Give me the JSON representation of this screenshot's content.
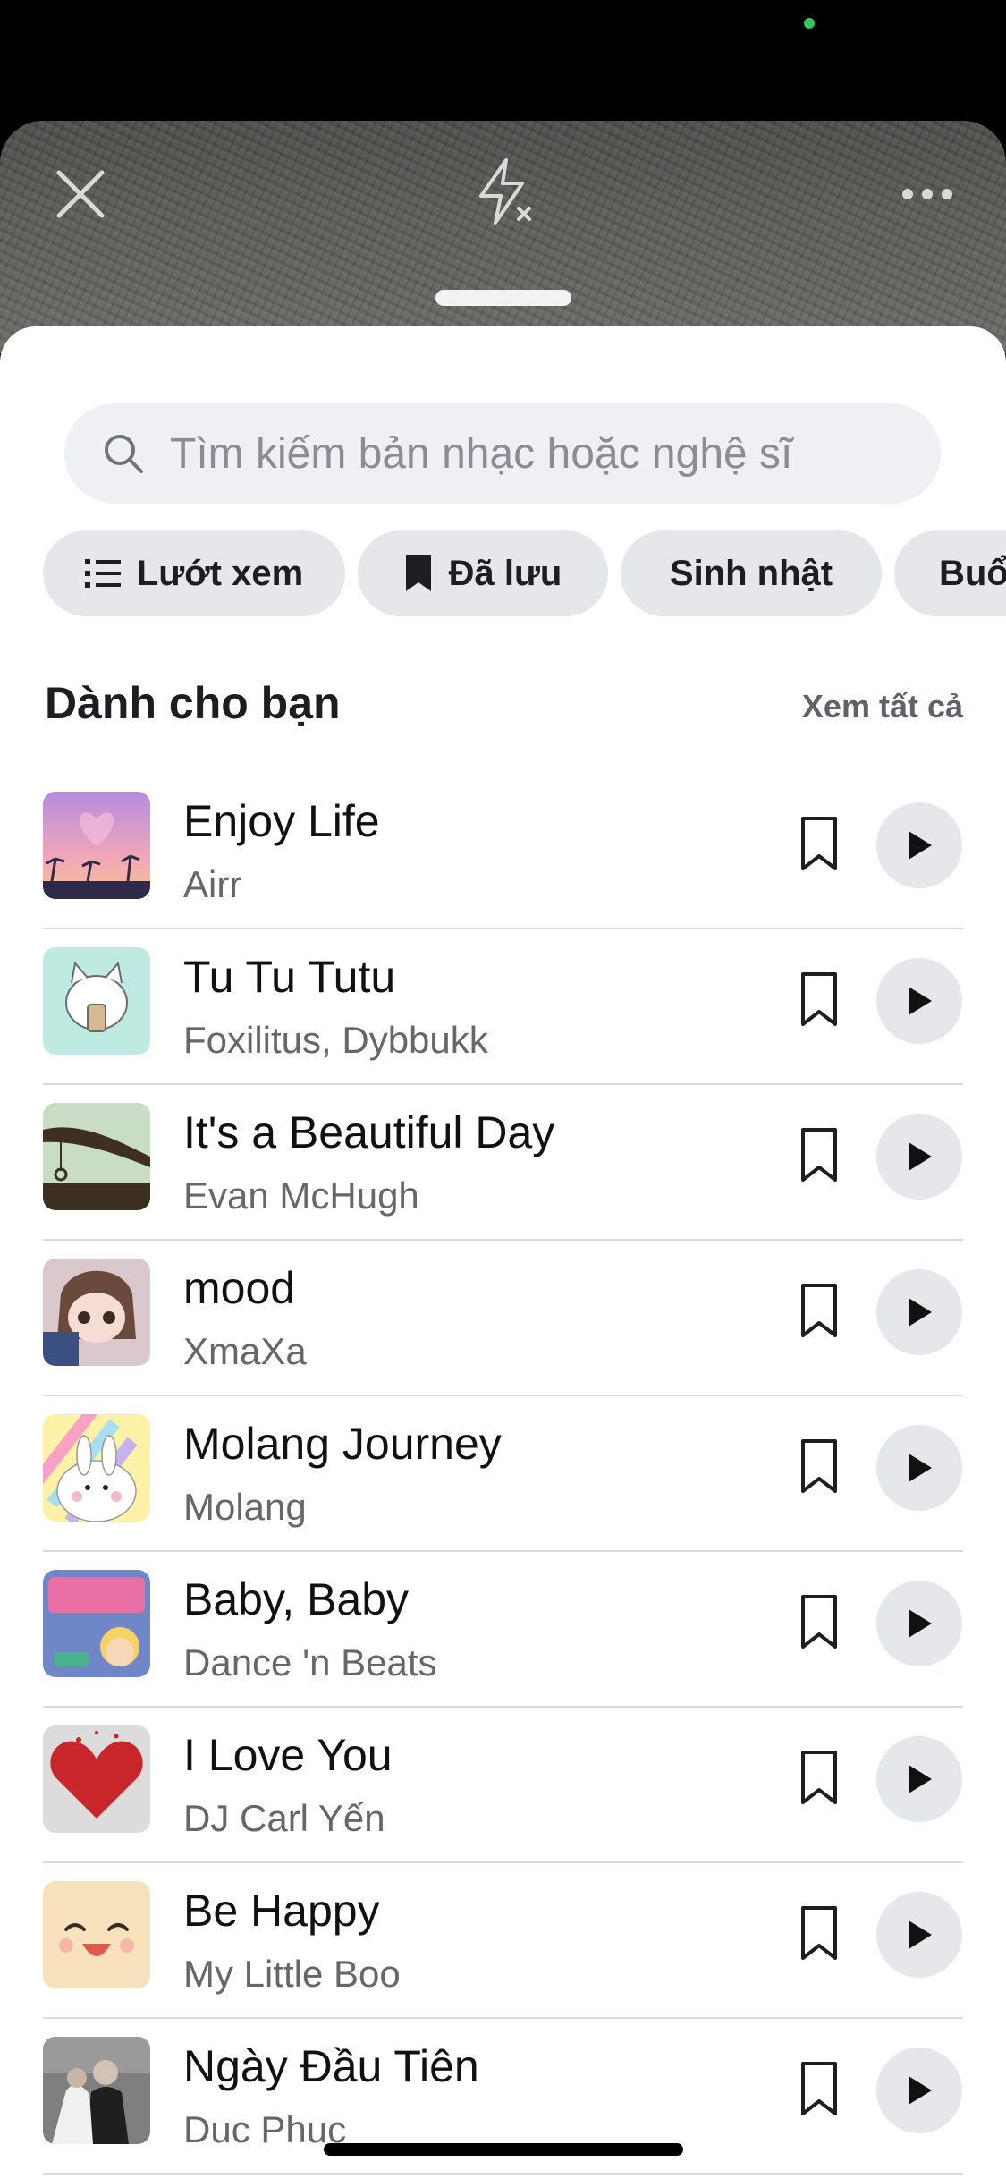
{
  "search": {
    "placeholder": "Tìm kiếm bản nhạc hoặc nghệ sĩ"
  },
  "chips": [
    {
      "label": "Lướt xem",
      "icon": "list-icon"
    },
    {
      "label": "Đã lưu",
      "icon": "bookmark-filled-icon"
    },
    {
      "label": "Sinh nhật"
    },
    {
      "label": "Buổ"
    }
  ],
  "section": {
    "title": "Dành cho bạn",
    "see_all": "Xem tất cả"
  },
  "songs": [
    {
      "title": "Enjoy Life",
      "artist": "Airr"
    },
    {
      "title": "Tu Tu Tutu",
      "artist": "Foxilitus, Dybbukk"
    },
    {
      "title": "It's a Beautiful Day",
      "artist": "Evan McHugh"
    },
    {
      "title": "mood",
      "artist": "XmaXa"
    },
    {
      "title": "Molang Journey",
      "artist": "Molang"
    },
    {
      "title": "Baby, Baby",
      "artist": "Dance 'n Beats"
    },
    {
      "title": "I Love You",
      "artist": "DJ Carl Yến"
    },
    {
      "title": "Be Happy",
      "artist": "My Little Boo"
    },
    {
      "title": "Ngày Đầu Tiên",
      "artist": "Duc Phuc"
    }
  ],
  "colors": {
    "accent_status": "#34c759",
    "chip_bg": "#e5e7eb",
    "text_primary": "#111111",
    "text_secondary": "#65676b"
  }
}
